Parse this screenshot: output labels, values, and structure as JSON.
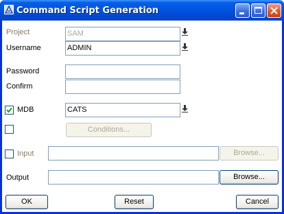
{
  "window": {
    "title": "Command Script Generation"
  },
  "form": {
    "project": {
      "label": "Project",
      "value": "SAM"
    },
    "username": {
      "label": "Username",
      "value": "ADMIN"
    },
    "password": {
      "label": "Password",
      "value": ""
    },
    "confirm": {
      "label": "Confirm",
      "value": ""
    },
    "mdb": {
      "label": "MDB",
      "checked": true,
      "value": "CATS"
    },
    "conditions": {
      "checked": false,
      "button_label": "Conditions..."
    },
    "input": {
      "label": "Input",
      "checked": false,
      "value": "",
      "browse_label": "Browse..."
    },
    "output": {
      "label": "Output",
      "value": "",
      "browse_label": "Browse..."
    }
  },
  "buttons": {
    "ok": "OK",
    "reset": "Reset",
    "cancel": "Cancel"
  },
  "colors": {
    "title_bar": "#0054e3",
    "close_button": "#e15a2f",
    "disabled_label": "#8a7a5a",
    "field_border": "#7f9db9"
  }
}
